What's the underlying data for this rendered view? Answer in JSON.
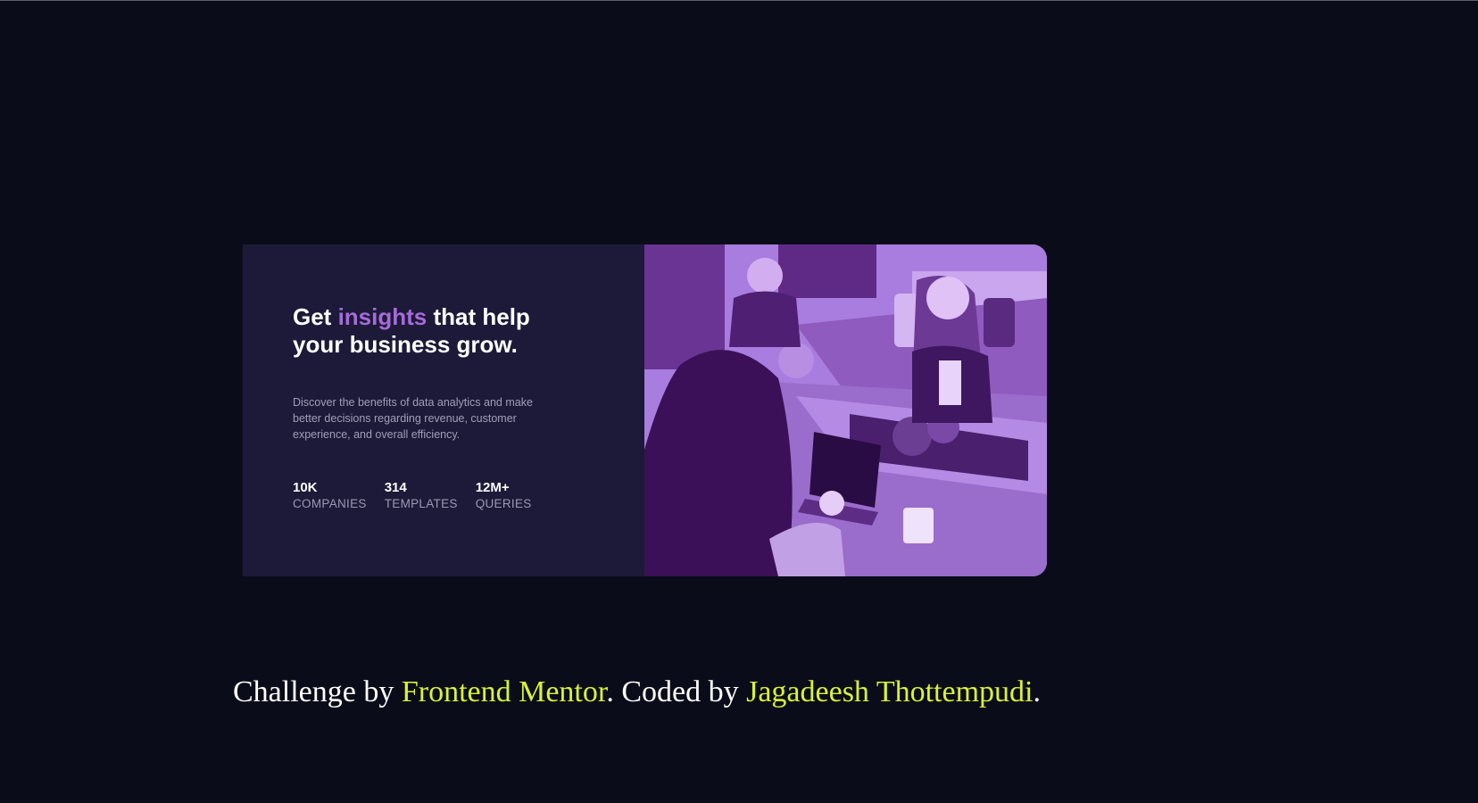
{
  "card": {
    "headline_start": "Get ",
    "headline_accent": "insights",
    "headline_end": " that help your business grow.",
    "description": "Discover the benefits of data analytics and make better decisions regarding revenue, customer experience, and overall efficiency.",
    "stats": [
      {
        "value": "10K",
        "label": "COMPANIES"
      },
      {
        "value": "314",
        "label": "TEMPLATES"
      },
      {
        "value": "12M+",
        "label": "QUERIES"
      }
    ]
  },
  "footer": {
    "prefix": "Challenge by ",
    "link1": "Frontend Mentor",
    "middle": ". Coded by ",
    "link2": "Jagadeesh Thottempudi",
    "suffix": "."
  },
  "colors": {
    "background": "#0a0c1a",
    "card": "#1c1a38",
    "accent": "#a66bd9",
    "link": "#d9f233"
  },
  "image": {
    "icon": "office-photo"
  }
}
